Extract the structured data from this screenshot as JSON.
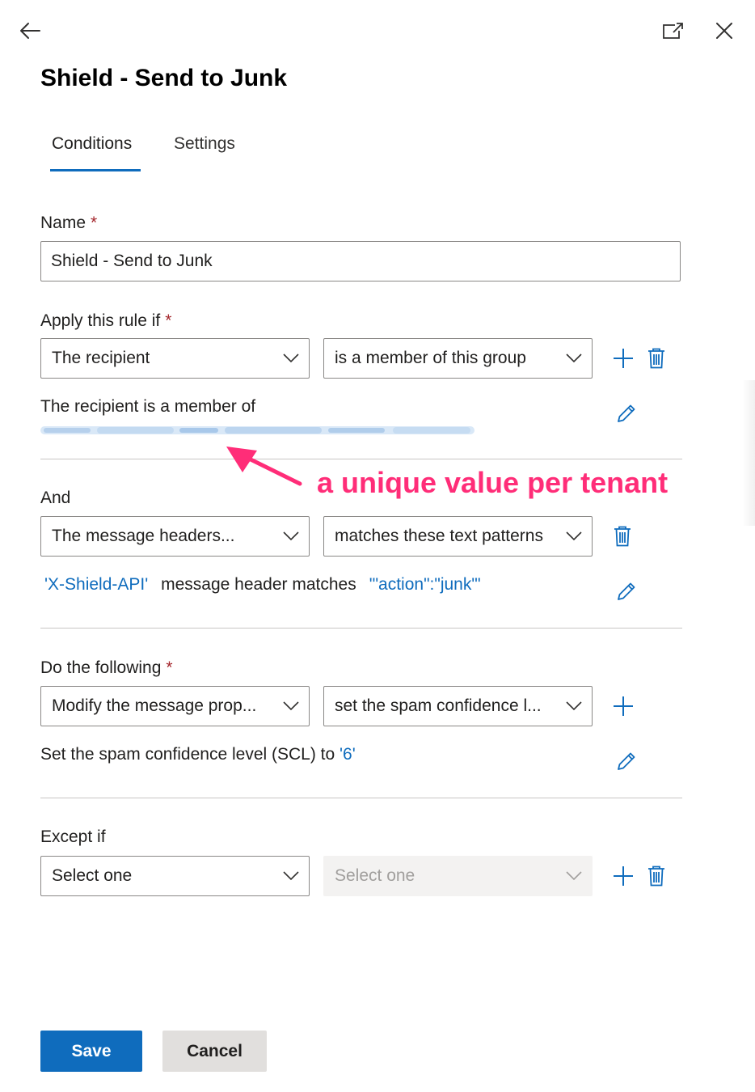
{
  "panel": {
    "title": "Shield - Send to Junk"
  },
  "tabs": [
    {
      "label": "Conditions",
      "active": true
    },
    {
      "label": "Settings",
      "active": false
    }
  ],
  "name_field": {
    "label": "Name",
    "required_mark": "*",
    "value": "Shield - Send to Junk"
  },
  "apply_rule": {
    "label": "Apply this rule if",
    "required_mark": "*",
    "condition_value": "The recipient",
    "operator_value": "is a member of this group",
    "description": "The recipient is a member of",
    "group_value_redacted": true
  },
  "annotation": {
    "text": "a unique value per tenant",
    "color": "#ff2d78"
  },
  "and_rule": {
    "label": "And",
    "condition_value": "The message headers...",
    "operator_value": "matches these text patterns",
    "header_name": "'X-Shield-API'",
    "middle_text": "message header matches",
    "pattern": "'\"action\":\"junk\"'"
  },
  "do_following": {
    "label": "Do the following",
    "required_mark": "*",
    "action_value": "Modify the message prop...",
    "property_value": "set the spam confidence l...",
    "description": "Set the spam confidence level (SCL) to",
    "scl_value": "'6'"
  },
  "except_if": {
    "label": "Except if",
    "condition_value": "Select one",
    "operator_value": "Select one",
    "operator_disabled": true
  },
  "footer": {
    "save_label": "Save",
    "cancel_label": "Cancel"
  },
  "colors": {
    "accent": "#0f6cbd",
    "required": "#a4262c",
    "divider": "#c8c6c4"
  },
  "icons": [
    "back-arrow-icon",
    "open-in-new-window-icon",
    "close-icon",
    "chevron-down-icon",
    "add-icon",
    "delete-icon",
    "edit-pencil-icon"
  ]
}
